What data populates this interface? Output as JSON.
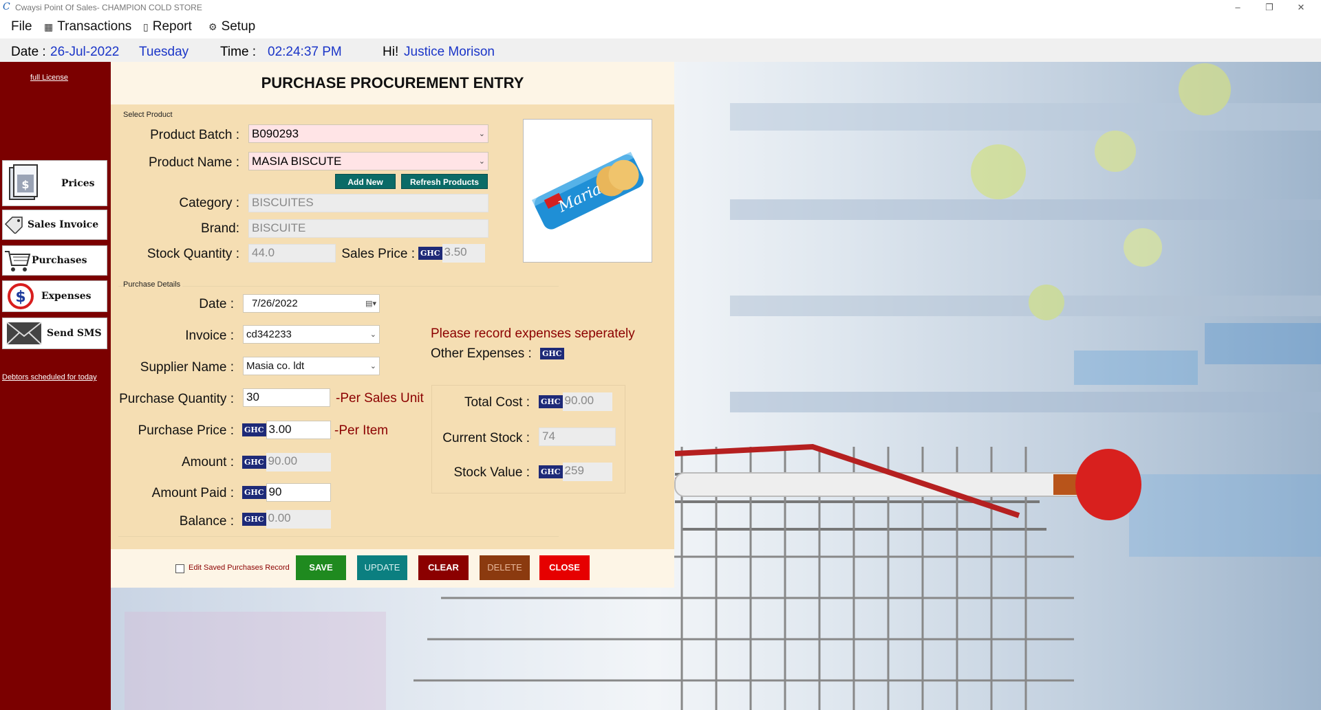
{
  "window": {
    "title": "Cwaysi Point Of Sales- CHAMPION COLD STORE",
    "minimize": "–",
    "restore": "❐",
    "close": "✕"
  },
  "menu": [
    {
      "label": "File",
      "icon": ""
    },
    {
      "label": "Transactions",
      "icon": "transactions-icon"
    },
    {
      "label": "Report",
      "icon": "report-icon"
    },
    {
      "label": "Setup",
      "icon": "setup-gear-icon"
    }
  ],
  "info": {
    "date_label": "Date :",
    "date_value": "26-Jul-2022",
    "day": "Tuesday",
    "time_label": "Time :",
    "time_value": "02:24:37 PM",
    "greeting": "Hi!",
    "user": "Justice Morison"
  },
  "sidebar": {
    "license_link": "full License",
    "buttons": [
      {
        "label": "Prices",
        "icon": "price-tag-icon"
      },
      {
        "label": "Sales Invoice",
        "icon": "sales-tag-icon"
      },
      {
        "label": "Purchases",
        "icon": "shopping-cart-icon"
      },
      {
        "label": "Expenses",
        "icon": "dollar-circle-icon"
      },
      {
        "label": "Send SMS",
        "icon": "envelope-icon"
      }
    ],
    "debtors_link": "Debtors scheduled for today"
  },
  "form": {
    "title": "PURCHASE PROCUREMENT ENTRY",
    "select_product_label": "Select Product",
    "product_batch_label": "Product Batch :",
    "product_batch_value": "B090293",
    "product_name_label": "Product Name :",
    "product_name_value": "MASIA BISCUTE",
    "add_new_label": "Add New",
    "refresh_products_label": "Refresh Products",
    "category_label": "Category :",
    "category_value": "BISCUITES",
    "brand_label": "Brand:",
    "brand_value": "BISCUITE",
    "stock_qty_label": "Stock Quantity :",
    "stock_qty_value": "44.0",
    "sales_price_label": "Sales Price :",
    "sales_price_value": "3.50",
    "currency": "GHC",
    "purchase_details_label": "Purchase Details",
    "date_label": "Date :",
    "date_value": "7/26/2022",
    "invoice_label": "Invoice :",
    "invoice_value": "cd342233",
    "supplier_label": "Supplier Name :",
    "supplier_value": "Masia co. ldt",
    "purchase_qty_label": "Purchase Quantity :",
    "purchase_qty_value": "30",
    "per_sales_unit": "-Per Sales Unit",
    "purchase_price_label": "Purchase Price :",
    "purchase_price_value": "3.00",
    "per_item": "-Per Item",
    "amount_label": "Amount :",
    "amount_value": "90.00",
    "amount_paid_label": "Amount Paid :",
    "amount_paid_value": "90",
    "balance_label": "Balance :",
    "balance_value": "0.00",
    "expenses_note": "Please record expenses seperately",
    "other_expenses_label": "Other Expenses :",
    "total_cost_label": "Total Cost :",
    "total_cost_value": "90.00",
    "current_stock_label": "Current Stock :",
    "current_stock_value": "74",
    "stock_value_label": "Stock Value :",
    "stock_value_value": "259"
  },
  "actions": {
    "edit_saved_label": "Edit Saved Purchases Record",
    "save": "SAVE",
    "update": "UPDATE",
    "clear": "CLEAR",
    "delete": "DELETE",
    "close": "CLOSE"
  },
  "colors": {
    "sidebar": "#7b0000",
    "panel": "#f5deb3",
    "accent_blue": "#1a35c8",
    "save": "#1f8a1f",
    "update": "#0b7f80",
    "clear": "#8b0000",
    "delete": "#8b3a0f",
    "close": "#e60000"
  }
}
